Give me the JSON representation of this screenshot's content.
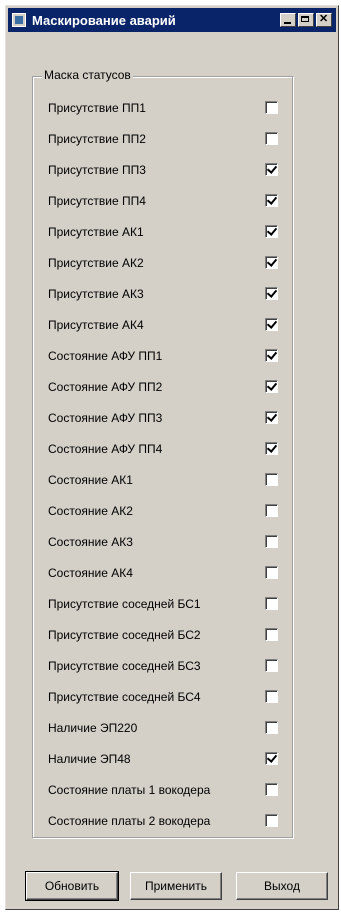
{
  "window": {
    "title": "Маскирование аварий"
  },
  "group": {
    "title": "Маска статусов",
    "items": [
      {
        "label": "Присутствие ПП1",
        "checked": false
      },
      {
        "label": "Присутствие ПП2",
        "checked": false
      },
      {
        "label": "Присутствие ПП3",
        "checked": true
      },
      {
        "label": "Присутствие ПП4",
        "checked": true
      },
      {
        "label": "Присутствие АК1",
        "checked": true
      },
      {
        "label": "Присутствие  АК2",
        "checked": true
      },
      {
        "label": "Присутствие АК3",
        "checked": true
      },
      {
        "label": "Присутствие АК4",
        "checked": true
      },
      {
        "label": "Состояние АФУ ПП1",
        "checked": true
      },
      {
        "label": "Состояние АФУ ПП2",
        "checked": true
      },
      {
        "label": "Состояние АФУ ПП3",
        "checked": true
      },
      {
        "label": "Состояние АФУ ПП4",
        "checked": true
      },
      {
        "label": "Состояние АК1",
        "checked": false
      },
      {
        "label": "Состояние АК2",
        "checked": false
      },
      {
        "label": "Состояние АК3",
        "checked": false
      },
      {
        "label": "Состояние АК4",
        "checked": false
      },
      {
        "label": "Присутствие соседней БС1",
        "checked": false
      },
      {
        "label": "Присутствие соседней БС2",
        "checked": false
      },
      {
        "label": "Присутствие соседней БС3",
        "checked": false
      },
      {
        "label": "Присутствие соседней БС4",
        "checked": false
      },
      {
        "label": "Наличие ЭП220",
        "checked": false
      },
      {
        "label": "Наличие ЭП48",
        "checked": true
      },
      {
        "label": "Состояние платы 1 вокодера",
        "checked": false
      },
      {
        "label": "Состояние платы 2 вокодера",
        "checked": false
      }
    ]
  },
  "buttons": {
    "refresh": "Обновить",
    "apply": "Применить",
    "exit": "Выход"
  }
}
